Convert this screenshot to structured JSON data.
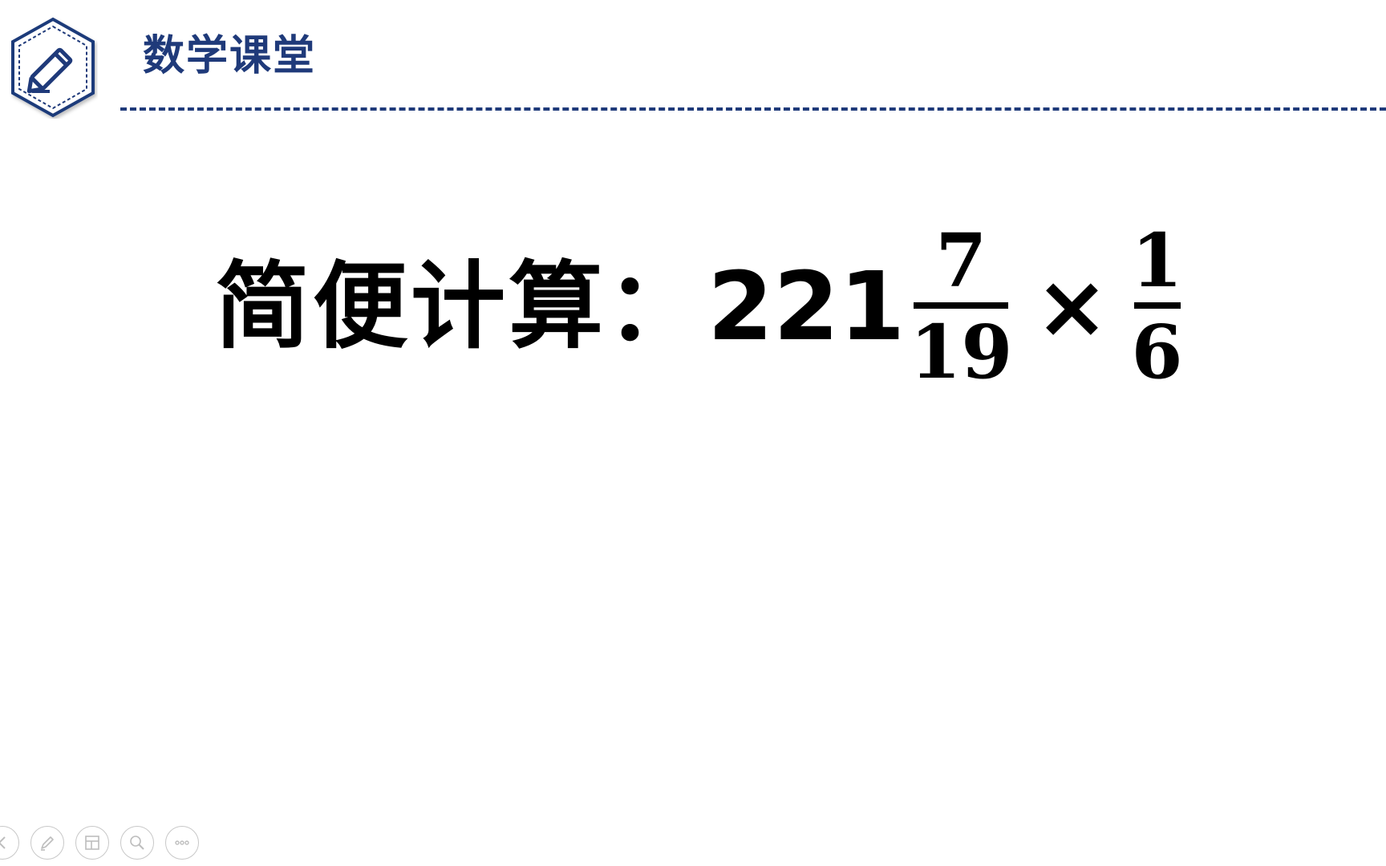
{
  "header": {
    "title": "数学课堂",
    "accent_color": "#1f3a7a"
  },
  "equation": {
    "label": "简便计算：",
    "whole": "221",
    "fraction_a": {
      "numerator": "7",
      "denominator": "19"
    },
    "operator": "×",
    "fraction_b": {
      "numerator": "1",
      "denominator": "6"
    }
  },
  "toolbar": {
    "buttons": [
      {
        "icon": "arrow-icon"
      },
      {
        "icon": "pen-icon"
      },
      {
        "icon": "slides-icon"
      },
      {
        "icon": "zoom-icon"
      },
      {
        "icon": "more-icon"
      }
    ]
  }
}
